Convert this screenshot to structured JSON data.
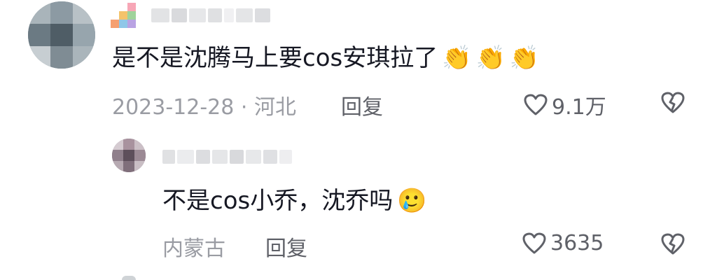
{
  "comments": [
    {
      "text": "是不是沈腾马上要cos安琪拉了",
      "emoji": "👏👏👏",
      "date_location": "2023-12-28 · 河北",
      "reply_label": "回复",
      "likes": "9.1万",
      "icons": {
        "like": "heart-outline-icon",
        "dislike": "broken-heart-icon"
      }
    },
    {
      "text": "不是cos小乔，沈乔吗",
      "emoji": "🥲",
      "location": "内蒙古",
      "reply_label": "回复",
      "likes": "3635",
      "icons": {
        "like": "heart-outline-icon",
        "dislike": "broken-heart-icon"
      }
    }
  ],
  "colors": {
    "text": "#161823",
    "meta": "#9a9ca3",
    "action": "#5f6168"
  }
}
